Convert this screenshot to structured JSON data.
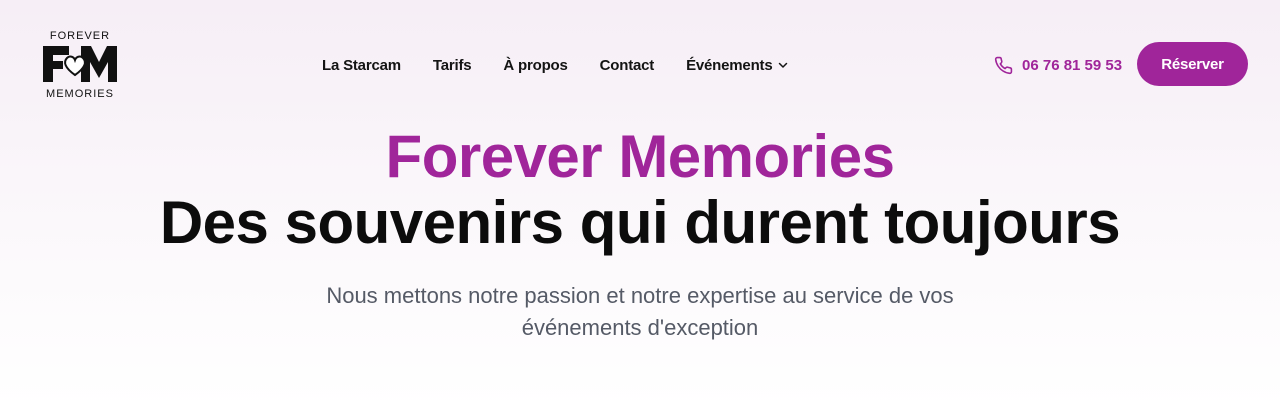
{
  "logo": {
    "top_text": "FOREVER",
    "monogram": "FM",
    "bottom_text": "MEMORIES",
    "icon": "heart-icon"
  },
  "nav": {
    "items": [
      {
        "label": "La Starcam"
      },
      {
        "label": "Tarifs"
      },
      {
        "label": "À propos"
      },
      {
        "label": "Contact"
      },
      {
        "label": "Événements",
        "has_dropdown": true,
        "icon": "chevron-down-icon"
      }
    ]
  },
  "contact": {
    "phone": "06 76 81 59 53",
    "icon": "phone-icon"
  },
  "cta": {
    "label": "Réserver"
  },
  "hero": {
    "brand_title": "Forever Memories",
    "title": "Des souvenirs qui durent toujours",
    "subtitle": "Nous mettons notre passion et notre expertise au service de vos événements d'exception"
  },
  "colors": {
    "accent": "#a0259a",
    "text": "#111111",
    "muted": "#555a66"
  }
}
